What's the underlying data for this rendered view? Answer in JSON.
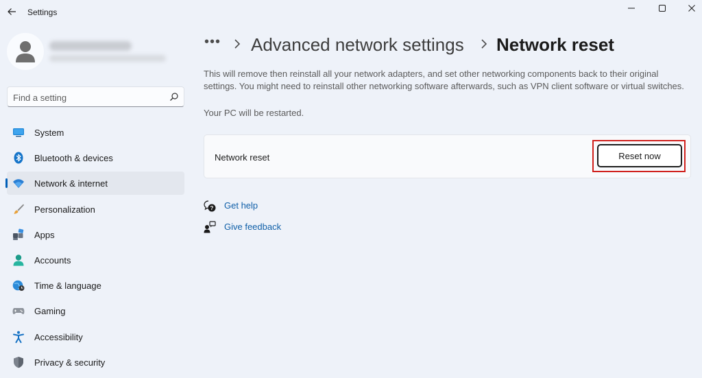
{
  "window": {
    "title": "Settings"
  },
  "search": {
    "placeholder": "Find a setting"
  },
  "sidebar": {
    "items": [
      {
        "label": "System",
        "icon": "monitor-icon"
      },
      {
        "label": "Bluetooth & devices",
        "icon": "bluetooth-icon"
      },
      {
        "label": "Network & internet",
        "icon": "wifi-icon",
        "active": true
      },
      {
        "label": "Personalization",
        "icon": "brush-icon"
      },
      {
        "label": "Apps",
        "icon": "apps-icon"
      },
      {
        "label": "Accounts",
        "icon": "person-icon"
      },
      {
        "label": "Time & language",
        "icon": "globe-clock-icon"
      },
      {
        "label": "Gaming",
        "icon": "gamepad-icon"
      },
      {
        "label": "Accessibility",
        "icon": "accessibility-icon"
      },
      {
        "label": "Privacy & security",
        "icon": "shield-icon"
      }
    ]
  },
  "breadcrumb": {
    "more": "•••",
    "parent": "Advanced network settings",
    "current": "Network reset"
  },
  "main": {
    "description": "This will remove then reinstall all your network adapters, and set other networking components back to their original settings. You might need to reinstall other networking software afterwards, such as VPN client software or virtual switches.",
    "restart_note": "Your PC will be restarted.",
    "card": {
      "label": "Network reset",
      "button_label": "Reset now"
    },
    "links": {
      "get_help": "Get help",
      "give_feedback": "Give feedback"
    }
  },
  "colors": {
    "accent": "#005fb8",
    "link": "#0f5fa8",
    "highlight": "#d0201c",
    "background": "#eef2f9"
  }
}
